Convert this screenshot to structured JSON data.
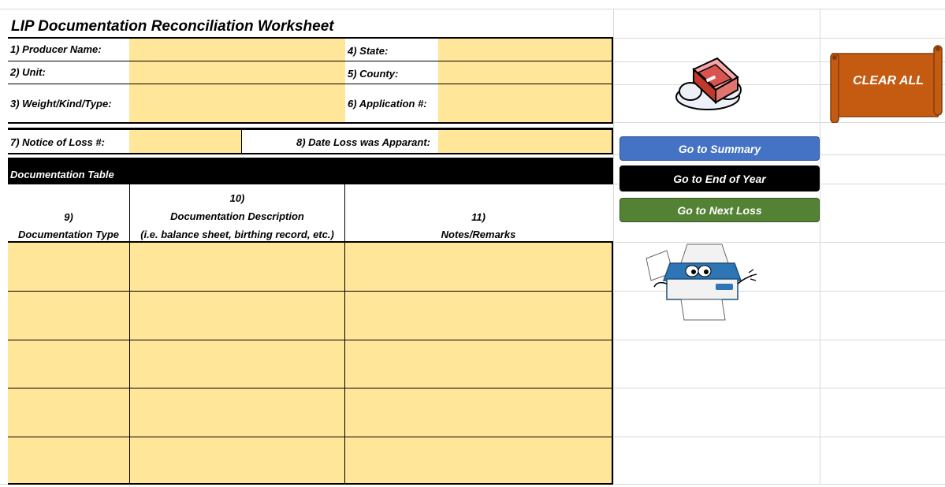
{
  "sheet": {
    "title": "LIP Documentation Reconciliation Worksheet",
    "fields": {
      "producer_name": "1) Producer Name:",
      "unit": "2) Unit:",
      "weight_kind_type": "3) Weight/Kind/Type:",
      "state": "4) State:",
      "county": "5) County:",
      "application_no": "6) Application #:",
      "notice_of_loss": "7) Notice of Loss #:",
      "date_loss_apparent": "8) Date Loss was Apparant:"
    },
    "doc_table": {
      "title": "Documentation Table",
      "col1": {
        "num": "9)",
        "label": "Documentation Type"
      },
      "col2": {
        "num": "10)",
        "label": "Documentation Description",
        "sub": "(i.e. balance sheet, birthing record, etc.)"
      },
      "col3": {
        "num": "11)",
        "label": "Notes/Remarks"
      }
    }
  },
  "buttons": {
    "clear_all": "CLEAR ALL",
    "summary": "Go to Summary",
    "end_of_year": "Go to End of Year",
    "next_loss": "Go to Next Loss"
  },
  "colors": {
    "input_fill": "#ffe699",
    "clear_all": "#c55a11",
    "summary": "#4472c4",
    "end_of_year": "#000000",
    "next_loss": "#548235"
  },
  "icons": {
    "eraser": "eraser-icon",
    "printer": "printer-icon"
  }
}
